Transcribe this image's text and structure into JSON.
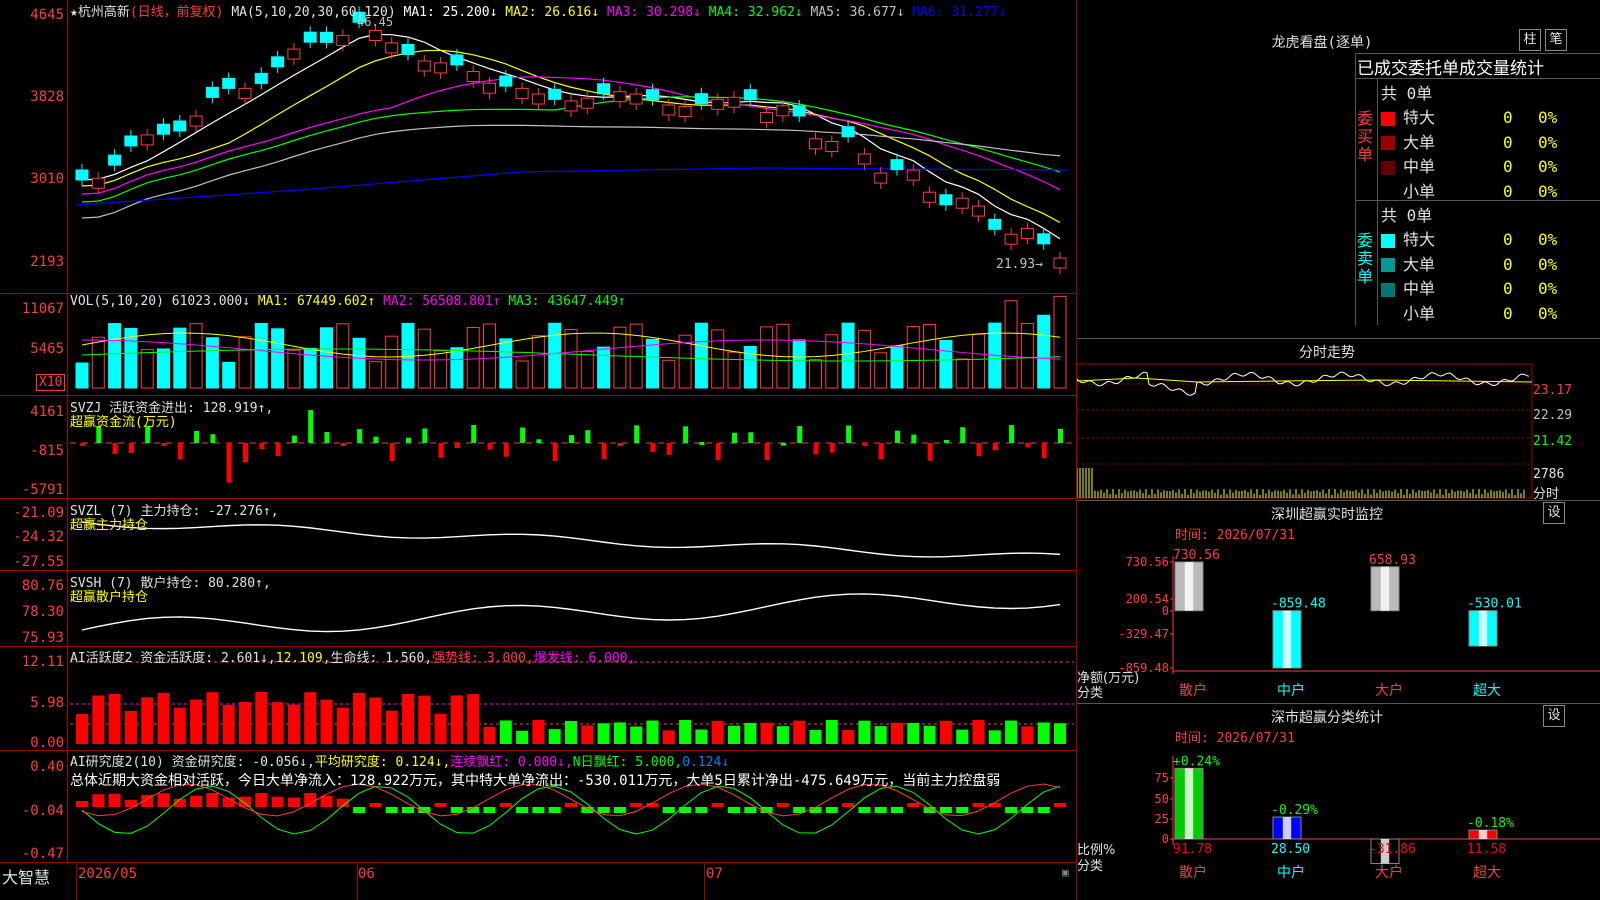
{
  "app": {
    "brand": "大智慧"
  },
  "main": {
    "stock": "杭州高新",
    "period_label": "(日线，前复权)",
    "ma_title": "MA(5,10,20,30,60,120)",
    "ma_items": [
      {
        "label": "MA1: 25.200↓",
        "color": "#ffffff"
      },
      {
        "label": "MA2: 26.616↓",
        "color": "#ffff00"
      },
      {
        "label": "MA3: 30.298↓",
        "color": "#ff00ff"
      },
      {
        "label": "MA4: 32.962↓",
        "color": "#00ff00"
      },
      {
        "label": "MA5: 36.677↓",
        "color": "#c0c0c0"
      },
      {
        "label": "MA6: 31.277↓",
        "color": "#0000ff"
      }
    ],
    "y_ticks": [
      "4645",
      "3828",
      "3010",
      "2193"
    ],
    "high_label": "46.45",
    "low_label": "21.93→",
    "dates": [
      "2026/05",
      "06",
      "07"
    ]
  },
  "vol": {
    "title": "VOL(5,10,20)",
    "value": "61023.000↓",
    "ma_items": [
      {
        "label": "MA1: 67449.602↑",
        "color": "#ffff00"
      },
      {
        "label": "MA2: 56508.801↑",
        "color": "#ff00ff"
      },
      {
        "label": "MA3: 43647.449↑",
        "color": "#00ff00"
      }
    ],
    "y_ticks": [
      "11067",
      "5465"
    ],
    "unit": "X10"
  },
  "svzj": {
    "title": "SVZJ  活跃资金进出: 128.919↑,",
    "subtitle": "超赢资金流(万元)",
    "y_ticks": [
      "4161",
      "-815",
      "-5791"
    ]
  },
  "svzl": {
    "title": "SVZL (7) 主力持仓: -27.276↑,",
    "subtitle": "超赢主力持仓",
    "y_ticks": [
      "-21.09",
      "-24.32",
      "-27.55"
    ]
  },
  "svsh": {
    "title": "SVSH (7) 散户持仓: 80.280↑,",
    "subtitle": "超赢散户持仓",
    "y_ticks": [
      "80.76",
      "78.30",
      "75.93"
    ]
  },
  "ai_active": {
    "title": "AI活跃度2 资金活跃度: 2.601↓,",
    "v2": "12.109,",
    "v3": "生命线: 1.560,",
    "v4": "强势线: 3.000,",
    "v5": "爆发线: 6.000,",
    "y_ticks": [
      "12.11",
      "5.98",
      "0.00"
    ]
  },
  "ai_research": {
    "title": "AI研究度2(10) 资金研究度: -0.056↓,",
    "v2": "平均研究度: 0.124↓,",
    "v3": "连续飘红: 0.000↓,",
    "v4": "N日飘红: 5.000,",
    "v5": "0.124↓",
    "summary": "总体近期大资金相对活跃，今日大单净流入：128.922万元，其中特大单净流出：-530.011万元，大单5日累计净出-475.649万元，当前主力控盘弱",
    "y_ticks": [
      "0.40",
      "-0.04",
      "-0.47"
    ]
  },
  "dragon_tiger": {
    "title": "龙虎看盘(逐单)",
    "btn1": "柱",
    "btn2": "笔",
    "subtitle": "已成交委托单成交量统计",
    "buy_side": "委买单",
    "sell_side": "委卖单",
    "buy_total": "共 0单",
    "sell_total": "共 0单",
    "buy_rows": [
      {
        "name": "特大",
        "count": "0",
        "pct": "0%",
        "color": "#ff0000"
      },
      {
        "name": "大单",
        "count": "0",
        "pct": "0%",
        "color": "#990000"
      },
      {
        "name": "中单",
        "count": "0",
        "pct": "0%",
        "color": "#660000"
      },
      {
        "name": "小单",
        "count": "0",
        "pct": "0%",
        "color": "#000000"
      }
    ],
    "sell_rows": [
      {
        "name": "特大",
        "count": "0",
        "pct": "0%",
        "color": "#00ffff"
      },
      {
        "name": "大单",
        "count": "0",
        "pct": "0%",
        "color": "#009999"
      },
      {
        "name": "中单",
        "count": "0",
        "pct": "0%",
        "color": "#007777"
      },
      {
        "name": "小单",
        "count": "0",
        "pct": "0%",
        "color": "#000000"
      }
    ]
  },
  "intraday": {
    "title": "分时走势",
    "y_ticks": [
      "23.17",
      "22.29",
      "21.42",
      "2786",
      "分时"
    ]
  },
  "monitor": {
    "title": "深圳超赢实时监控",
    "btn": "设",
    "time": "时间: 2026/07/31",
    "y_ticks": [
      "730.56",
      "200.54",
      "0",
      "-329.47",
      "-859.48"
    ],
    "ylabel1": "净额(万元)",
    "ylabel2": "分类"
  },
  "classify": {
    "title": "深市超赢分类统计",
    "btn": "设",
    "time": "时间: 2026/07/31",
    "y_ticks": [
      "75",
      "50",
      "25",
      "0"
    ],
    "ylabel1": "比例%",
    "ylabel2": "分类"
  },
  "chart_data": [
    {
      "type": "bar",
      "name": "net",
      "categories": [
        "散户",
        "中户",
        "大户",
        "超大"
      ],
      "values": [
        730.56,
        -859.48,
        658.93,
        -530.01
      ],
      "value_labels": [
        "730.56",
        "-859.48",
        "658.93",
        "-530.01"
      ],
      "ylim": [
        -859.48,
        730.56
      ]
    },
    {
      "type": "bar",
      "name": "ratio",
      "categories": [
        "散户",
        "中户",
        "大户",
        "超大"
      ],
      "values": [
        91.78,
        28.5,
        -31.86,
        11.58
      ],
      "value_labels": [
        "91.78",
        "28.50",
        "-31.86",
        "11.58"
      ],
      "top_labels": [
        "+0.24%",
        "-0.29%",
        "",
        "-0.18%"
      ],
      "cat_colors": [
        "#ff0000",
        "#00ffff",
        "#ff0000",
        "#ff0000"
      ],
      "ylim": [
        0,
        100
      ]
    }
  ]
}
